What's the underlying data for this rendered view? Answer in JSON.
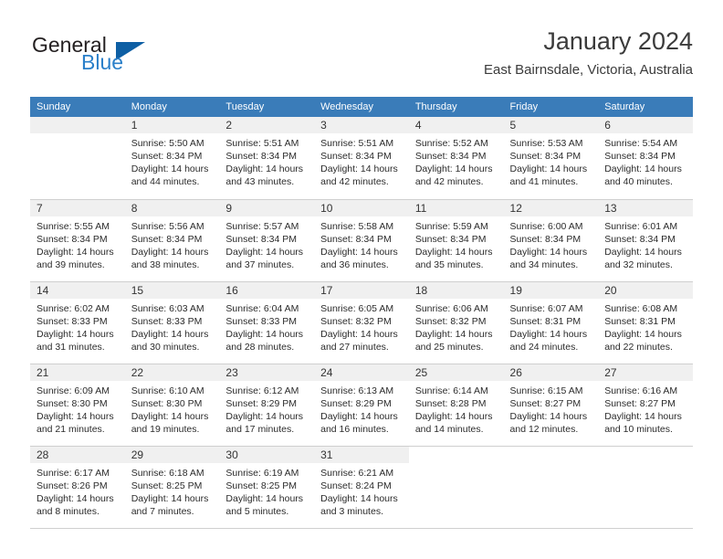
{
  "brand": {
    "name_part1": "General",
    "name_part2": "Blue",
    "triangle_icon": "triangle-icon",
    "color_dark": "#231f20",
    "color_blue": "#2a7fc9"
  },
  "header": {
    "title": "January 2024",
    "subtitle": "East Bairnsdale, Victoria, Australia"
  },
  "theme": {
    "header_row_bg": "#3a7cb9",
    "header_row_text": "#ffffff",
    "daynum_bg": "#f0f0f0",
    "grid_line": "#cfcfcf"
  },
  "weekday_headers": [
    "Sunday",
    "Monday",
    "Tuesday",
    "Wednesday",
    "Thursday",
    "Friday",
    "Saturday"
  ],
  "weeks": [
    [
      {
        "day": "",
        "sunrise": "",
        "sunset": "",
        "daylight_line1": "",
        "daylight_line2": "",
        "empty": true
      },
      {
        "day": "1",
        "sunrise": "Sunrise: 5:50 AM",
        "sunset": "Sunset: 8:34 PM",
        "daylight_line1": "Daylight: 14 hours",
        "daylight_line2": "and 44 minutes."
      },
      {
        "day": "2",
        "sunrise": "Sunrise: 5:51 AM",
        "sunset": "Sunset: 8:34 PM",
        "daylight_line1": "Daylight: 14 hours",
        "daylight_line2": "and 43 minutes."
      },
      {
        "day": "3",
        "sunrise": "Sunrise: 5:51 AM",
        "sunset": "Sunset: 8:34 PM",
        "daylight_line1": "Daylight: 14 hours",
        "daylight_line2": "and 42 minutes."
      },
      {
        "day": "4",
        "sunrise": "Sunrise: 5:52 AM",
        "sunset": "Sunset: 8:34 PM",
        "daylight_line1": "Daylight: 14 hours",
        "daylight_line2": "and 42 minutes."
      },
      {
        "day": "5",
        "sunrise": "Sunrise: 5:53 AM",
        "sunset": "Sunset: 8:34 PM",
        "daylight_line1": "Daylight: 14 hours",
        "daylight_line2": "and 41 minutes."
      },
      {
        "day": "6",
        "sunrise": "Sunrise: 5:54 AM",
        "sunset": "Sunset: 8:34 PM",
        "daylight_line1": "Daylight: 14 hours",
        "daylight_line2": "and 40 minutes."
      }
    ],
    [
      {
        "day": "7",
        "sunrise": "Sunrise: 5:55 AM",
        "sunset": "Sunset: 8:34 PM",
        "daylight_line1": "Daylight: 14 hours",
        "daylight_line2": "and 39 minutes."
      },
      {
        "day": "8",
        "sunrise": "Sunrise: 5:56 AM",
        "sunset": "Sunset: 8:34 PM",
        "daylight_line1": "Daylight: 14 hours",
        "daylight_line2": "and 38 minutes."
      },
      {
        "day": "9",
        "sunrise": "Sunrise: 5:57 AM",
        "sunset": "Sunset: 8:34 PM",
        "daylight_line1": "Daylight: 14 hours",
        "daylight_line2": "and 37 minutes."
      },
      {
        "day": "10",
        "sunrise": "Sunrise: 5:58 AM",
        "sunset": "Sunset: 8:34 PM",
        "daylight_line1": "Daylight: 14 hours",
        "daylight_line2": "and 36 minutes."
      },
      {
        "day": "11",
        "sunrise": "Sunrise: 5:59 AM",
        "sunset": "Sunset: 8:34 PM",
        "daylight_line1": "Daylight: 14 hours",
        "daylight_line2": "and 35 minutes."
      },
      {
        "day": "12",
        "sunrise": "Sunrise: 6:00 AM",
        "sunset": "Sunset: 8:34 PM",
        "daylight_line1": "Daylight: 14 hours",
        "daylight_line2": "and 34 minutes."
      },
      {
        "day": "13",
        "sunrise": "Sunrise: 6:01 AM",
        "sunset": "Sunset: 8:34 PM",
        "daylight_line1": "Daylight: 14 hours",
        "daylight_line2": "and 32 minutes."
      }
    ],
    [
      {
        "day": "14",
        "sunrise": "Sunrise: 6:02 AM",
        "sunset": "Sunset: 8:33 PM",
        "daylight_line1": "Daylight: 14 hours",
        "daylight_line2": "and 31 minutes."
      },
      {
        "day": "15",
        "sunrise": "Sunrise: 6:03 AM",
        "sunset": "Sunset: 8:33 PM",
        "daylight_line1": "Daylight: 14 hours",
        "daylight_line2": "and 30 minutes."
      },
      {
        "day": "16",
        "sunrise": "Sunrise: 6:04 AM",
        "sunset": "Sunset: 8:33 PM",
        "daylight_line1": "Daylight: 14 hours",
        "daylight_line2": "and 28 minutes."
      },
      {
        "day": "17",
        "sunrise": "Sunrise: 6:05 AM",
        "sunset": "Sunset: 8:32 PM",
        "daylight_line1": "Daylight: 14 hours",
        "daylight_line2": "and 27 minutes."
      },
      {
        "day": "18",
        "sunrise": "Sunrise: 6:06 AM",
        "sunset": "Sunset: 8:32 PM",
        "daylight_line1": "Daylight: 14 hours",
        "daylight_line2": "and 25 minutes."
      },
      {
        "day": "19",
        "sunrise": "Sunrise: 6:07 AM",
        "sunset": "Sunset: 8:31 PM",
        "daylight_line1": "Daylight: 14 hours",
        "daylight_line2": "and 24 minutes."
      },
      {
        "day": "20",
        "sunrise": "Sunrise: 6:08 AM",
        "sunset": "Sunset: 8:31 PM",
        "daylight_line1": "Daylight: 14 hours",
        "daylight_line2": "and 22 minutes."
      }
    ],
    [
      {
        "day": "21",
        "sunrise": "Sunrise: 6:09 AM",
        "sunset": "Sunset: 8:30 PM",
        "daylight_line1": "Daylight: 14 hours",
        "daylight_line2": "and 21 minutes."
      },
      {
        "day": "22",
        "sunrise": "Sunrise: 6:10 AM",
        "sunset": "Sunset: 8:30 PM",
        "daylight_line1": "Daylight: 14 hours",
        "daylight_line2": "and 19 minutes."
      },
      {
        "day": "23",
        "sunrise": "Sunrise: 6:12 AM",
        "sunset": "Sunset: 8:29 PM",
        "daylight_line1": "Daylight: 14 hours",
        "daylight_line2": "and 17 minutes."
      },
      {
        "day": "24",
        "sunrise": "Sunrise: 6:13 AM",
        "sunset": "Sunset: 8:29 PM",
        "daylight_line1": "Daylight: 14 hours",
        "daylight_line2": "and 16 minutes."
      },
      {
        "day": "25",
        "sunrise": "Sunrise: 6:14 AM",
        "sunset": "Sunset: 8:28 PM",
        "daylight_line1": "Daylight: 14 hours",
        "daylight_line2": "and 14 minutes."
      },
      {
        "day": "26",
        "sunrise": "Sunrise: 6:15 AM",
        "sunset": "Sunset: 8:27 PM",
        "daylight_line1": "Daylight: 14 hours",
        "daylight_line2": "and 12 minutes."
      },
      {
        "day": "27",
        "sunrise": "Sunrise: 6:16 AM",
        "sunset": "Sunset: 8:27 PM",
        "daylight_line1": "Daylight: 14 hours",
        "daylight_line2": "and 10 minutes."
      }
    ],
    [
      {
        "day": "28",
        "sunrise": "Sunrise: 6:17 AM",
        "sunset": "Sunset: 8:26 PM",
        "daylight_line1": "Daylight: 14 hours",
        "daylight_line2": "and 8 minutes."
      },
      {
        "day": "29",
        "sunrise": "Sunrise: 6:18 AM",
        "sunset": "Sunset: 8:25 PM",
        "daylight_line1": "Daylight: 14 hours",
        "daylight_line2": "and 7 minutes."
      },
      {
        "day": "30",
        "sunrise": "Sunrise: 6:19 AM",
        "sunset": "Sunset: 8:25 PM",
        "daylight_line1": "Daylight: 14 hours",
        "daylight_line2": "and 5 minutes."
      },
      {
        "day": "31",
        "sunrise": "Sunrise: 6:21 AM",
        "sunset": "Sunset: 8:24 PM",
        "daylight_line1": "Daylight: 14 hours",
        "daylight_line2": "and 3 minutes."
      },
      {
        "day": "",
        "sunrise": "",
        "sunset": "",
        "daylight_line1": "",
        "daylight_line2": "",
        "blank": true
      },
      {
        "day": "",
        "sunrise": "",
        "sunset": "",
        "daylight_line1": "",
        "daylight_line2": "",
        "blank": true
      },
      {
        "day": "",
        "sunrise": "",
        "sunset": "",
        "daylight_line1": "",
        "daylight_line2": "",
        "blank": true
      }
    ]
  ]
}
